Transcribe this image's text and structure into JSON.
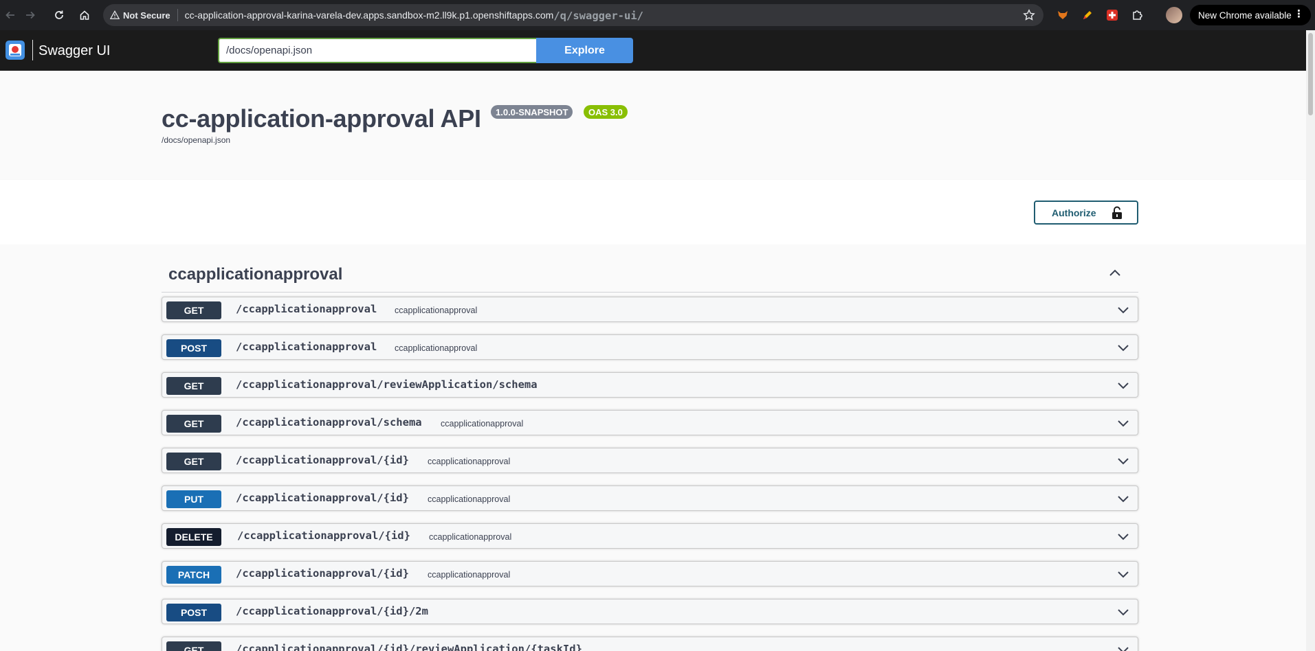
{
  "browser": {
    "security_label": "Not Secure",
    "url_host": "cc-application-approval-karina-varela-dev.apps.sandbox-m2.ll9k.p1.openshiftapps.com",
    "url_path": "/q/swagger-ui/",
    "update_label": "New Chrome available",
    "menu_glyph": "⋮"
  },
  "topbar": {
    "logo_text": "Swagger UI",
    "spec_url_value": "/docs/openapi.json",
    "explore_label": "Explore"
  },
  "info": {
    "title": "cc-application-approval API",
    "version_badge": "1.0.0-SNAPSHOT",
    "oas_badge": "OAS 3.0",
    "spec_link": "/docs/openapi.json"
  },
  "schemes": {
    "authorize_label": "Authorize"
  },
  "tag": {
    "name": "ccapplicationapproval"
  },
  "operations": [
    {
      "method": "GET",
      "path": "/ccapplicationapproval",
      "summary": "ccapplicationapproval"
    },
    {
      "method": "POST",
      "path": "/ccapplicationapproval",
      "summary": "ccapplicationapproval"
    },
    {
      "method": "GET",
      "path": "/ccapplicationapproval/reviewApplication/schema",
      "summary": ""
    },
    {
      "method": "GET",
      "path": "/ccapplicationapproval/schema",
      "summary": "ccapplicationapproval"
    },
    {
      "method": "GET",
      "path": "/ccapplicationapproval/{id}",
      "summary": "ccapplicationapproval"
    },
    {
      "method": "PUT",
      "path": "/ccapplicationapproval/{id}",
      "summary": "ccapplicationapproval"
    },
    {
      "method": "DELETE",
      "path": "/ccapplicationapproval/{id}",
      "summary": "ccapplicationapproval"
    },
    {
      "method": "PATCH",
      "path": "/ccapplicationapproval/{id}",
      "summary": "ccapplicationapproval"
    },
    {
      "method": "POST",
      "path": "/ccapplicationapproval/{id}/2m",
      "summary": ""
    },
    {
      "method": "GET",
      "path": "/ccapplicationapproval/{id}/reviewApplication/{taskId}",
      "summary": ""
    }
  ],
  "colors": {
    "get": "#2e3c4e",
    "post": "#184c83",
    "put": "#1a6fb5",
    "delete": "#141d2e",
    "patch": "#1a6fb5",
    "explore": "#4990e2",
    "oas_badge": "#89bf04",
    "version_badge": "#7d8492"
  }
}
